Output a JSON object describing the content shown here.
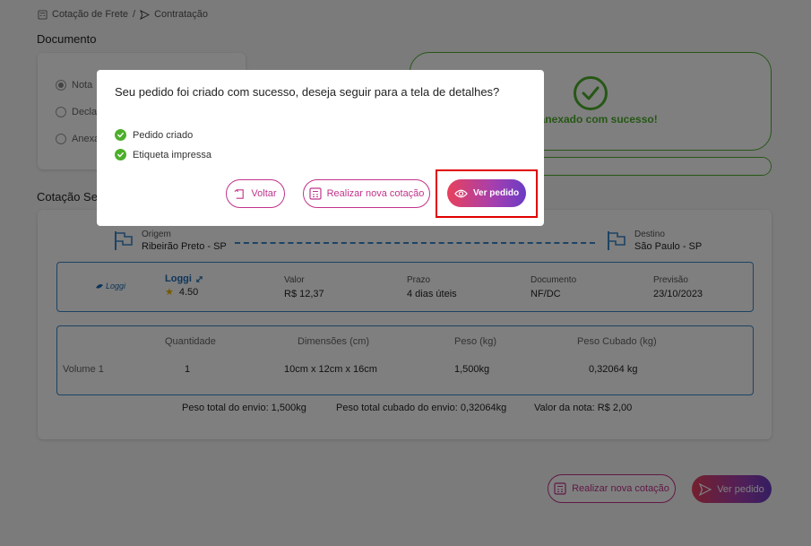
{
  "breadcrumb": {
    "parent": "Cotação de Frete",
    "separator": "/",
    "current": "Contratação"
  },
  "sections": {
    "document": "Documento",
    "quote_selected": "Cotação Sel"
  },
  "document_options": [
    {
      "label": "Nota",
      "checked": true
    },
    {
      "label": "Decla",
      "checked": false
    },
    {
      "label": "Anexa",
      "checked": false
    }
  ],
  "upload": {
    "message": "vo anexado com sucesso!",
    "color": "#4caf2a"
  },
  "route": {
    "origin_label": "Origem",
    "origin_value": "Ribeirão Preto - SP",
    "destination_label": "Destino",
    "destination_value": "São Paulo - SP"
  },
  "carrier": {
    "logo_text": "Loggi",
    "name": "Loggi",
    "rating": "4.50",
    "columns": [
      {
        "label": "Valor",
        "value": "R$ 12,37"
      },
      {
        "label": "Prazo",
        "value": "4 dias úteis"
      },
      {
        "label": "Documento",
        "value": "NF/DC"
      },
      {
        "label": "Previsão",
        "value": "23/10/2023"
      }
    ]
  },
  "volumes": {
    "headers": [
      "Quantidade",
      "Dimensões (cm)",
      "Peso (kg)",
      "Peso Cubado (kg)"
    ],
    "row_label": "Volume 1",
    "row": [
      "1",
      "10cm x 12cm x 16cm",
      "1,500kg",
      "0,32064 kg"
    ]
  },
  "totals": {
    "weight": "Peso total do envio: 1,500kg",
    "cubed": "Peso total cubado do envio: 0,32064kg",
    "invoice": "Valor da nota: R$ 2,00"
  },
  "page_actions": {
    "new_quote": "Realizar nova cotação",
    "view_order": "Ver pedido"
  },
  "modal": {
    "title": "Seu pedido foi criado com sucesso, deseja seguir para a tela de detalhes?",
    "checks": [
      "Pedido criado",
      "Etiqueta impressa"
    ],
    "back": "Voltar",
    "new_quote": "Realizar nova cotação",
    "view_order": "Ver pedido"
  },
  "colors": {
    "accent_magenta": "#c0338a",
    "accent_purple": "#6a3cc4",
    "success": "#4caf2a",
    "border_blue": "#3a86c8",
    "highlight": "#e00000"
  }
}
